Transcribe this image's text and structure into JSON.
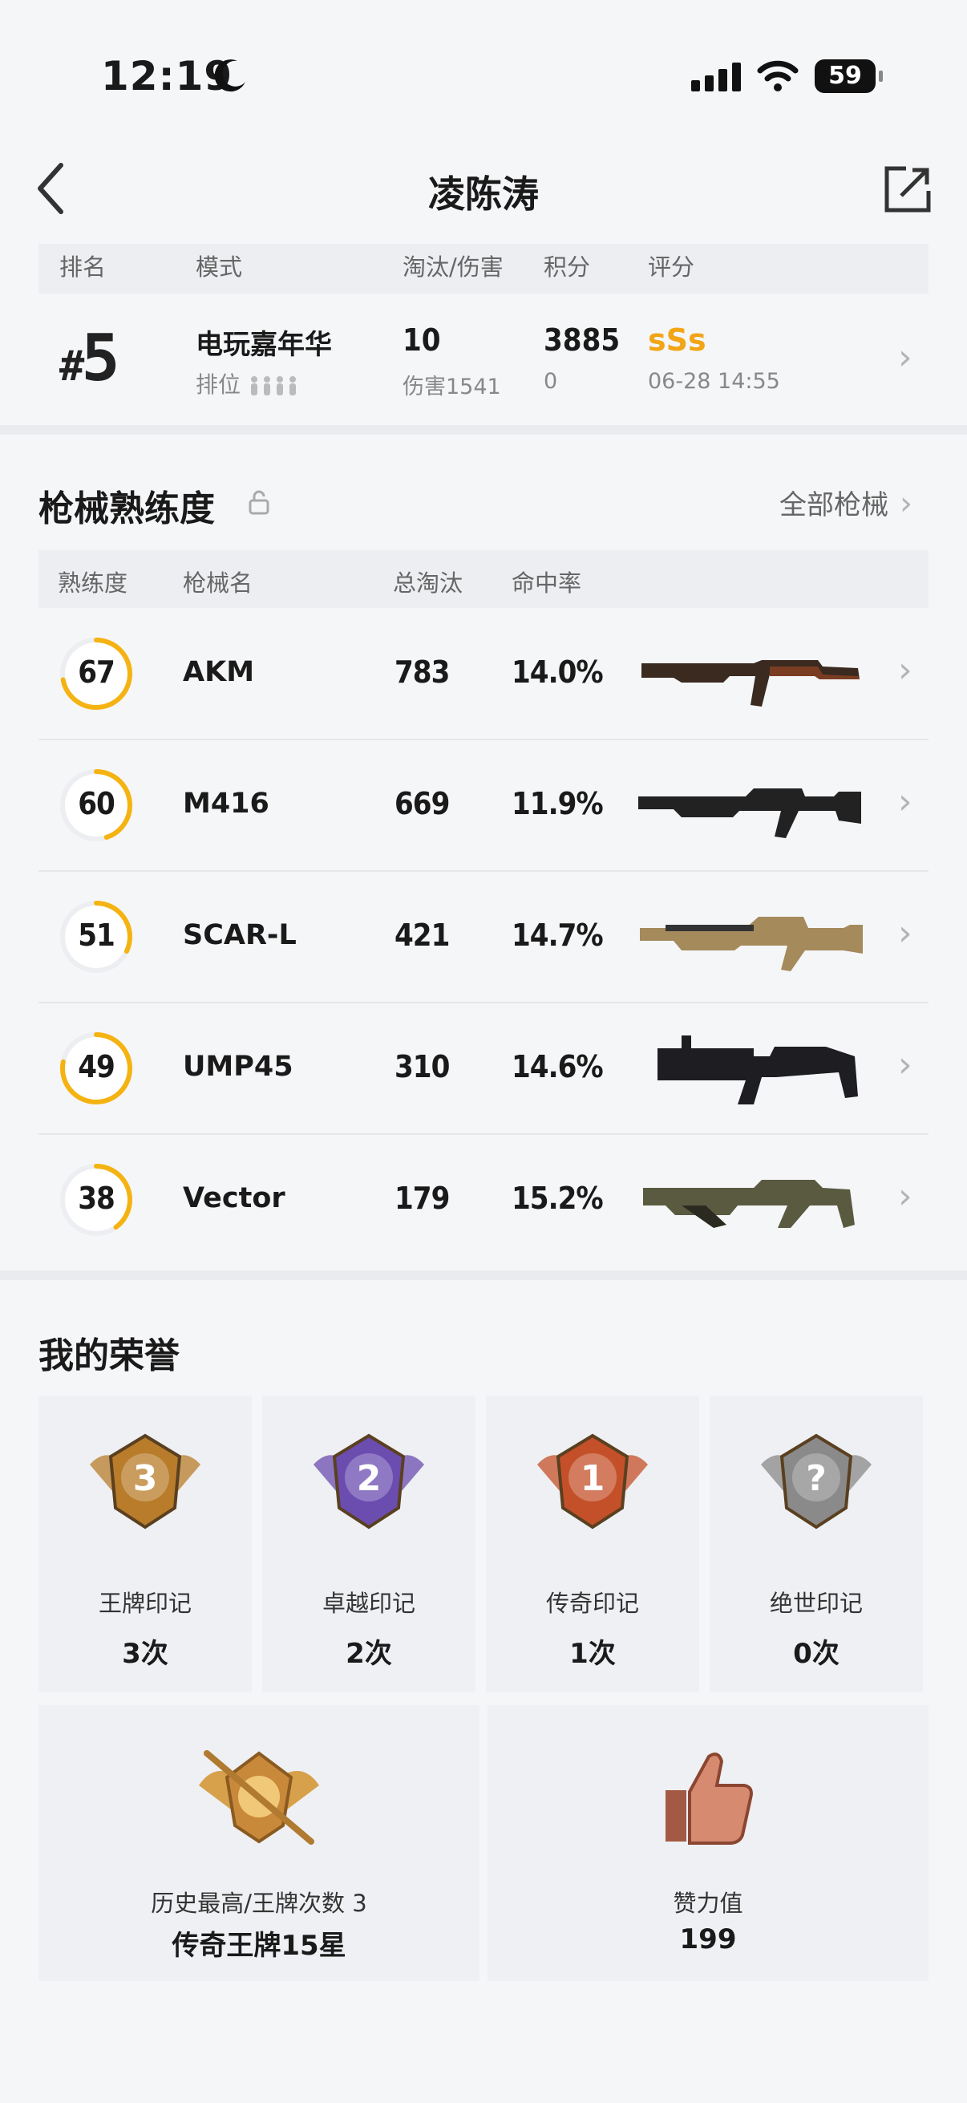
{
  "status_bar": {
    "time": "12:19",
    "battery": "59"
  },
  "nav": {
    "title": "凌陈涛"
  },
  "match_table": {
    "headers": {
      "rank": "排名",
      "mode": "模式",
      "kills_damage": "淘汰/伤害",
      "points": "积分",
      "rating": "评分"
    },
    "row": {
      "rank_prefix": "#",
      "rank": "5",
      "mode_name": "电玩嘉年华",
      "mode_sub": "排位",
      "kills": "10",
      "damage": "伤害1541",
      "points": "3885",
      "points_sub": "0",
      "grade": "sSs",
      "time": "06-28 14:55"
    }
  },
  "weapons": {
    "title": "枪械熟练度",
    "all_link": "全部枪械",
    "headers": {
      "mastery": "熟练度",
      "name": "枪械名",
      "kills": "总淘汰",
      "accuracy": "命中率"
    },
    "rows": [
      {
        "mastery": "67",
        "progress": 0.72,
        "name": "AKM",
        "kills": "783",
        "accuracy": "14.0%"
      },
      {
        "mastery": "60",
        "progress": 0.45,
        "name": "M416",
        "kills": "669",
        "accuracy": "11.9%"
      },
      {
        "mastery": "51",
        "progress": 0.32,
        "name": "SCAR-L",
        "kills": "421",
        "accuracy": "14.7%"
      },
      {
        "mastery": "49",
        "progress": 0.78,
        "name": "UMP45",
        "kills": "310",
        "accuracy": "14.6%"
      },
      {
        "mastery": "38",
        "progress": 0.4,
        "name": "Vector",
        "kills": "179",
        "accuracy": "15.2%"
      }
    ]
  },
  "honors": {
    "title": "我的荣誉",
    "badges": [
      {
        "label": "王牌印记",
        "count": "3次",
        "emblem": "3",
        "color": "#b87c2a"
      },
      {
        "label": "卓越印记",
        "count": "2次",
        "emblem": "2",
        "color": "#6b4db0"
      },
      {
        "label": "传奇印记",
        "count": "1次",
        "emblem": "1",
        "color": "#c4502a"
      },
      {
        "label": "绝世印记",
        "count": "0次",
        "emblem": "?",
        "color": "#8a8a8a"
      }
    ],
    "best": {
      "label": "历史最高/王牌次数 3",
      "value": "传奇王牌15星"
    },
    "likes": {
      "label": "赞力值",
      "value": "199"
    }
  }
}
